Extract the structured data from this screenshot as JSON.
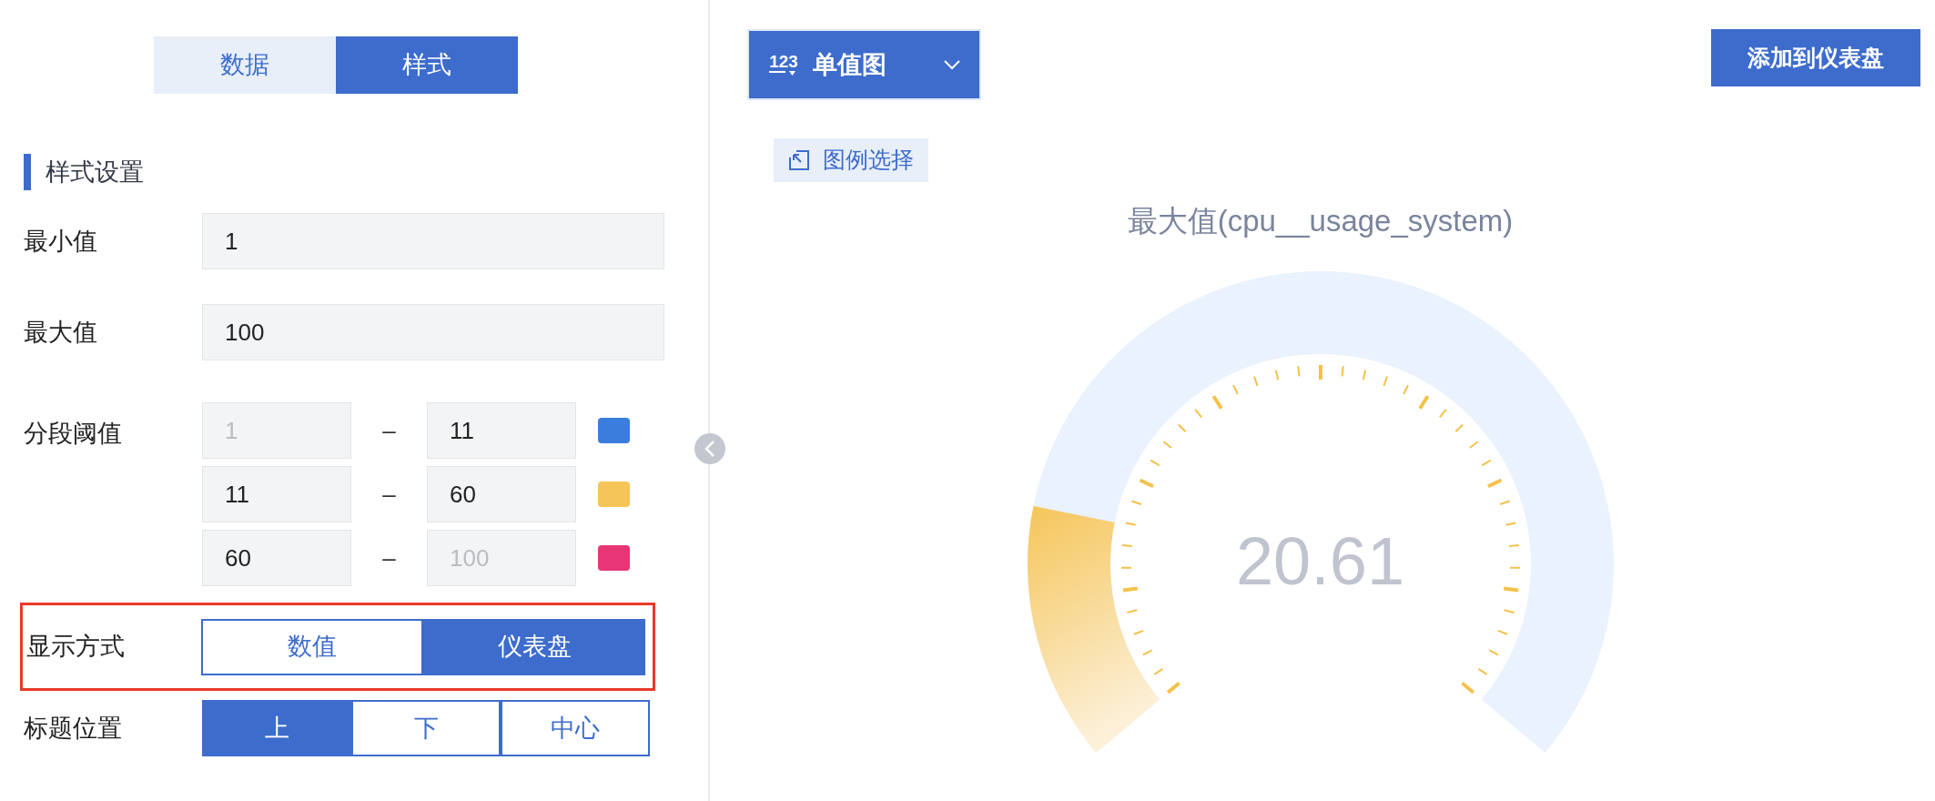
{
  "tabs": [
    {
      "label": "数据",
      "selected": false
    },
    {
      "label": "样式",
      "selected": true
    }
  ],
  "section_title": "样式设置",
  "fields": [
    {
      "label": "最小值",
      "value": "1"
    },
    {
      "label": "最大值",
      "value": "100"
    }
  ],
  "thresholds": {
    "label": "分段阈值",
    "rows": [
      {
        "from": {
          "value": "1",
          "disabled": true
        },
        "separator": "–",
        "to": {
          "value": "11",
          "disabled": false
        },
        "color": "#3b7ddd"
      },
      {
        "from": {
          "value": "11",
          "disabled": false
        },
        "separator": "–",
        "to": {
          "value": "60",
          "disabled": false
        },
        "color": "#f5c55a"
      },
      {
        "from": {
          "value": "60",
          "disabled": false
        },
        "separator": "–",
        "to": {
          "value": "100",
          "disabled": true
        },
        "color": "#e83575"
      }
    ]
  },
  "display_mode": {
    "label": "显示方式",
    "highlighted": true,
    "options": [
      {
        "label": "数值",
        "selected": false
      },
      {
        "label": "仪表盘",
        "selected": true
      }
    ]
  },
  "title_position": {
    "label": "标题位置",
    "options": [
      {
        "label": "上",
        "selected": true
      },
      {
        "label": "下",
        "selected": false
      },
      {
        "label": "中心",
        "selected": false
      }
    ]
  },
  "chart_type": {
    "icon_text": "123",
    "label": "单值图"
  },
  "add_button": "添加到仪表盘",
  "legend_button": "图例选择",
  "gauge": {
    "title": "最大值(cpu__usage_system)",
    "value": "20.61",
    "level": 0.198
  }
}
